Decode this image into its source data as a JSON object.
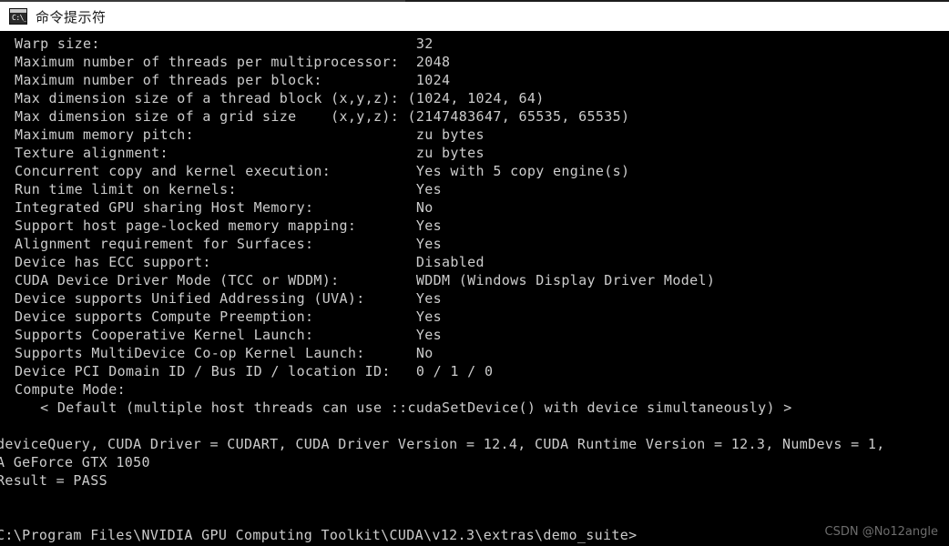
{
  "window": {
    "title": "命令提示符",
    "icon": "cmd-icon",
    "icon_glyph": "C:\\_"
  },
  "colors": {
    "terminal_background": "#000000",
    "terminal_foreground": "#cccccc",
    "titlebar_background": "#ffffff",
    "titlebar_foreground": "#1a1a1a",
    "watermark": "#6d6d6d"
  },
  "terminal": {
    "lines": [
      {
        "id": "warp-size",
        "text": "Warp size:                                     32",
        "clipped": false
      },
      {
        "id": "max-threads-per-mp",
        "text": "Maximum number of threads per multiprocessor:  2048",
        "clipped": false
      },
      {
        "id": "max-threads-per-block",
        "text": "Maximum number of threads per block:           1024",
        "clipped": false
      },
      {
        "id": "max-block-dim",
        "text": "Max dimension size of a thread block (x,y,z): (1024, 1024, 64)",
        "clipped": false
      },
      {
        "id": "max-grid-dim",
        "text": "Max dimension size of a grid size    (x,y,z): (2147483647, 65535, 65535)",
        "clipped": false
      },
      {
        "id": "max-memory-pitch",
        "text": "Maximum memory pitch:                          zu bytes",
        "clipped": false
      },
      {
        "id": "texture-alignment",
        "text": "Texture alignment:                             zu bytes",
        "clipped": false
      },
      {
        "id": "concurrent-copy",
        "text": "Concurrent copy and kernel execution:          Yes with 5 copy engine(s)",
        "clipped": false
      },
      {
        "id": "run-time-limit",
        "text": "Run time limit on kernels:                     Yes",
        "clipped": false
      },
      {
        "id": "integrated-gpu",
        "text": "Integrated GPU sharing Host Memory:            No",
        "clipped": false
      },
      {
        "id": "page-locked-mapping",
        "text": "Support host page-locked memory mapping:       Yes",
        "clipped": false
      },
      {
        "id": "surface-alignment",
        "text": "Alignment requirement for Surfaces:            Yes",
        "clipped": false
      },
      {
        "id": "ecc-support",
        "text": "Device has ECC support:                        Disabled",
        "clipped": false
      },
      {
        "id": "driver-mode",
        "text": "CUDA Device Driver Mode (TCC or WDDM):         WDDM (Windows Display Driver Model)",
        "clipped": false
      },
      {
        "id": "unified-addressing",
        "text": "Device supports Unified Addressing (UVA):      Yes",
        "clipped": false
      },
      {
        "id": "compute-preemption",
        "text": "Device supports Compute Preemption:            Yes",
        "clipped": false
      },
      {
        "id": "cooperative-launch",
        "text": "Supports Cooperative Kernel Launch:            Yes",
        "clipped": false
      },
      {
        "id": "multidevice-coop",
        "text": "Supports MultiDevice Co-op Kernel Launch:      No",
        "clipped": false
      },
      {
        "id": "pci-ids",
        "text": "Device PCI Domain ID / Bus ID / location ID:   0 / 1 / 0",
        "clipped": false
      },
      {
        "id": "compute-mode",
        "text": "Compute Mode:",
        "clipped": false
      },
      {
        "id": "compute-mode-detail",
        "text": "   < Default (multiple host threads can use ::cudaSetDevice() with device simultaneously) >",
        "clipped": false
      },
      {
        "id": "blank-1",
        "text": "",
        "clipped": false
      },
      {
        "id": "device-query-summary",
        "text": "deviceQuery, CUDA Driver = CUDART, CUDA Driver Version = 12.4, CUDA Runtime Version = 12.3, NumDevs = 1,",
        "clipped": true
      },
      {
        "id": "gpu-name",
        "text": "A GeForce GTX 1050",
        "clipped": true
      },
      {
        "id": "result",
        "text": "Result = PASS",
        "clipped": true
      },
      {
        "id": "blank-2",
        "text": "",
        "clipped": false
      },
      {
        "id": "blank-3",
        "text": "",
        "clipped": false
      },
      {
        "id": "prompt",
        "text": "C:\\Program Files\\NVIDIA GPU Computing Toolkit\\CUDA\\v12.3\\extras\\demo_suite>",
        "clipped": true
      }
    ]
  },
  "watermark": {
    "text": "CSDN @No12angle"
  }
}
